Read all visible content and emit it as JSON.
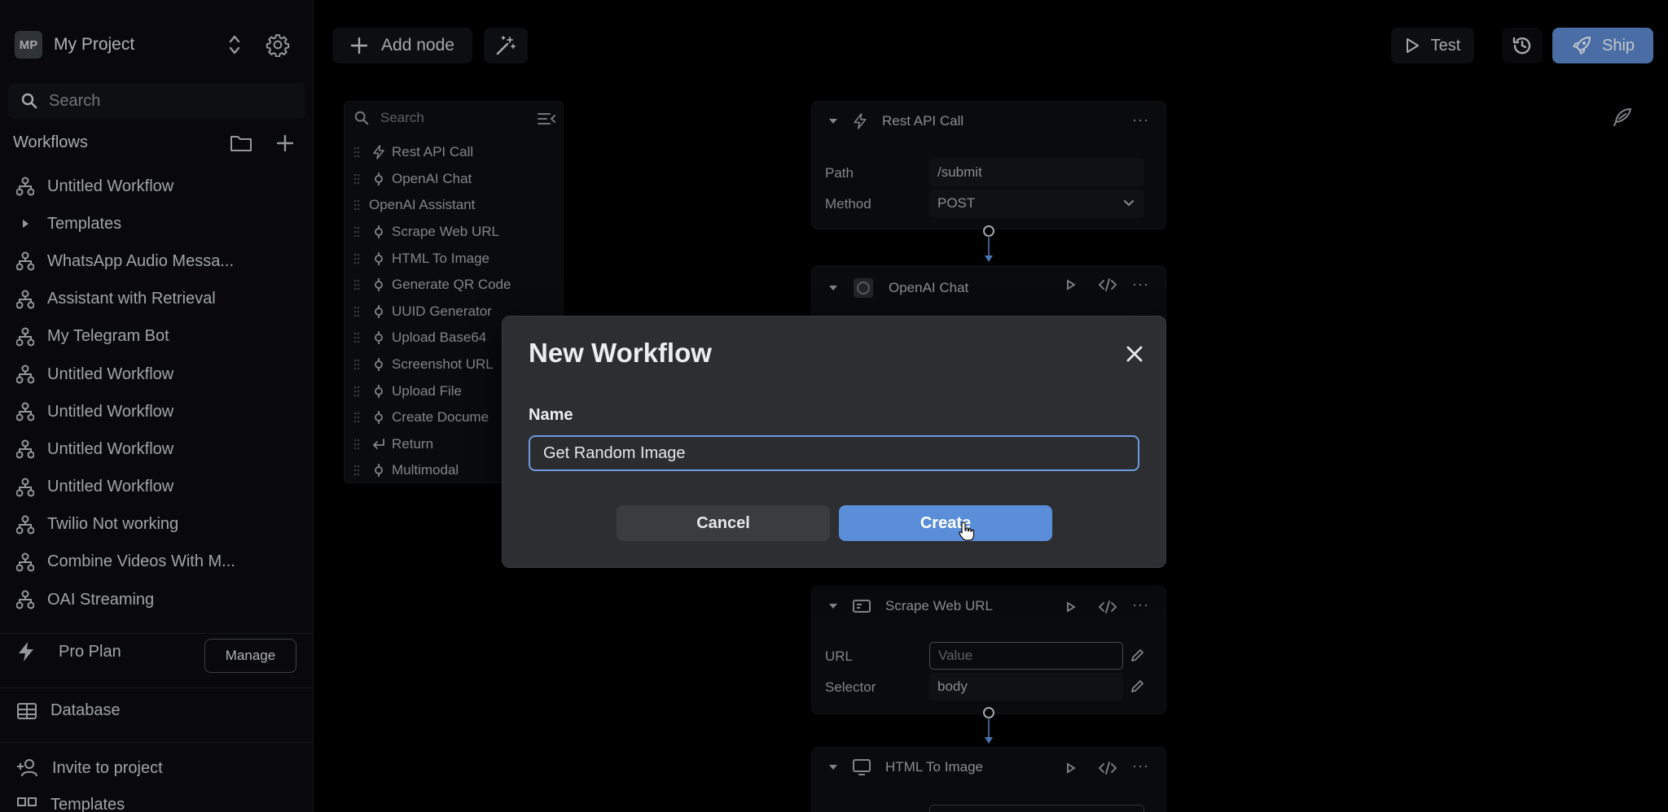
{
  "sidebar": {
    "project_initials": "MP",
    "project_name": "My Project",
    "search_placeholder": "Search",
    "workflows_heading": "Workflows",
    "items": [
      {
        "label": "Untitled Workflow",
        "icon": "workflow-icon"
      },
      {
        "label": "Templates",
        "icon": "caret-right-icon"
      },
      {
        "label": "WhatsApp Audio Messa...",
        "icon": "workflow-icon"
      },
      {
        "label": "Assistant with Retrieval",
        "icon": "workflow-icon"
      },
      {
        "label": "My Telegram Bot",
        "icon": "workflow-icon"
      },
      {
        "label": "Untitled Workflow",
        "icon": "workflow-icon"
      },
      {
        "label": "Untitled Workflow",
        "icon": "workflow-icon"
      },
      {
        "label": "Untitled Workflow",
        "icon": "workflow-icon"
      },
      {
        "label": "Untitled Workflow",
        "icon": "workflow-icon"
      },
      {
        "label": "Twilio Not working",
        "icon": "workflow-icon"
      },
      {
        "label": "Combine Videos With M...",
        "icon": "workflow-icon"
      },
      {
        "label": "OAI Streaming",
        "icon": "workflow-icon"
      }
    ],
    "plan_label": "Pro Plan",
    "manage_label": "Manage",
    "database_label": "Database",
    "invite_label": "Invite to project",
    "templates_label": "Templates"
  },
  "toolbar": {
    "add_node_label": "Add node",
    "test_label": "Test",
    "ship_label": "Ship"
  },
  "node_picker": {
    "search_placeholder": "Search",
    "items": [
      "Rest API Call",
      "OpenAI Chat",
      "OpenAI Assistant",
      "Scrape Web URL",
      "HTML To Image",
      "Generate QR Code",
      "UUID Generator",
      "Upload Base64",
      "Screenshot URL",
      "Upload File",
      "Create Docume",
      "Return",
      "Multimodal"
    ]
  },
  "nodes": {
    "rest": {
      "title": "Rest API Call",
      "path_label": "Path",
      "path_value": "/submit",
      "method_label": "Method",
      "method_value": "POST"
    },
    "openai": {
      "title": "OpenAI Chat"
    },
    "scrape": {
      "title": "Scrape Web URL",
      "url_label": "URL",
      "url_placeholder": "Value",
      "selector_label": "Selector",
      "selector_value": "body"
    },
    "html": {
      "title": "HTML To Image"
    }
  },
  "modal": {
    "title": "New Workflow",
    "name_label": "Name",
    "name_value": "Get Random Image",
    "cancel_label": "Cancel",
    "create_label": "Create"
  },
  "colors": {
    "accent": "#5b8ed8",
    "ship_button": "#5a86c8",
    "modal_bg": "#2d2e31",
    "input_border": "#6e9ae0"
  }
}
